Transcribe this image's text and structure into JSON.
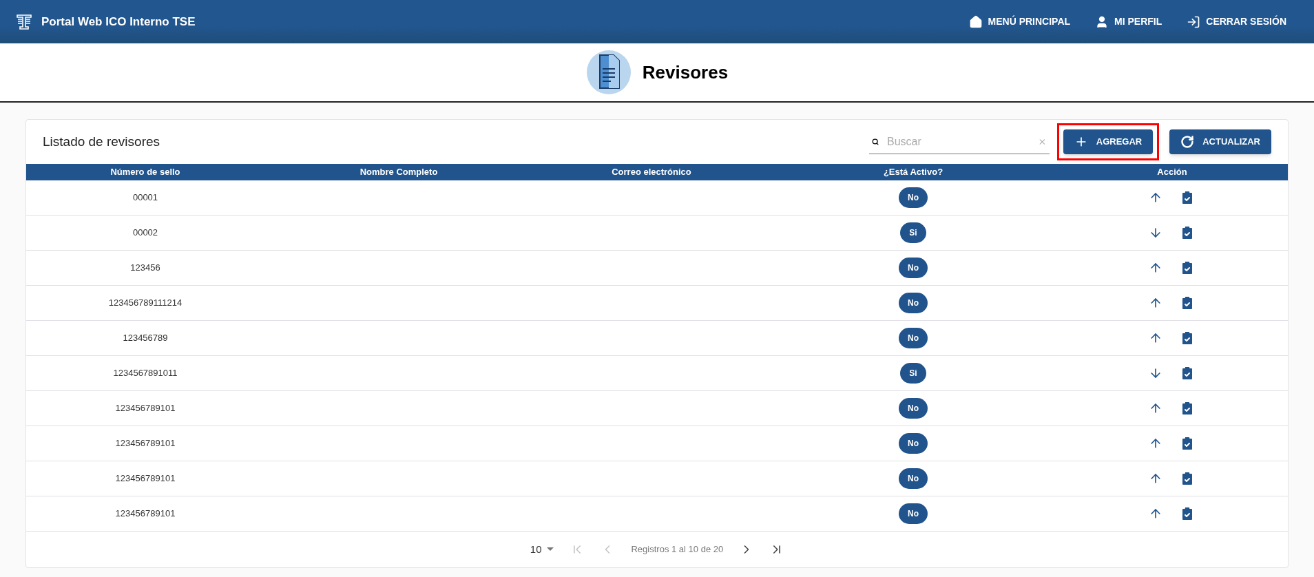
{
  "app_bar": {
    "title": "Portal Web ICO Interno TSE",
    "nav": [
      {
        "kind": "home",
        "label": "MENÚ PRINCIPAL"
      },
      {
        "kind": "profile",
        "label": "MI PERFIL"
      },
      {
        "kind": "logout",
        "label": "CERRAR SESIÓN"
      }
    ]
  },
  "page": {
    "title": "Revisores"
  },
  "card": {
    "title": "Listado de revisores",
    "search": {
      "placeholder": "Buscar"
    },
    "buttons": [
      {
        "kind": "add",
        "label": "AGREGAR",
        "highlighted": true
      },
      {
        "kind": "refresh",
        "label": "ACTUALIZAR",
        "highlighted": false
      }
    ]
  },
  "table": {
    "columns": [
      "Número de sello",
      "Nombre Completo",
      "Correo electrónico",
      "¿Está Activo?",
      "Acción"
    ],
    "rows": [
      {
        "seal": "00001",
        "active": false,
        "status": "No"
      },
      {
        "seal": "00002",
        "active": true,
        "status": "Si"
      },
      {
        "seal": "123456",
        "active": false,
        "status": "No"
      },
      {
        "seal": "123456789111214",
        "active": false,
        "status": "No"
      },
      {
        "seal": "123456789",
        "active": false,
        "status": "No"
      },
      {
        "seal": "1234567891011",
        "active": true,
        "status": "Si"
      },
      {
        "seal": "123456789101",
        "active": false,
        "status": "No"
      },
      {
        "seal": "123456789101",
        "active": false,
        "status": "No"
      },
      {
        "seal": "123456789101",
        "active": false,
        "status": "No"
      },
      {
        "seal": "123456789101",
        "active": false,
        "status": "No"
      }
    ]
  },
  "pagination": {
    "page_size": "10",
    "summary": "Registros 1 al 10 de 20",
    "controls": [
      {
        "kind": "first",
        "disabled": true
      },
      {
        "kind": "prev",
        "disabled": true
      },
      {
        "kind": "next",
        "disabled": false
      },
      {
        "kind": "last",
        "disabled": false
      }
    ]
  }
}
